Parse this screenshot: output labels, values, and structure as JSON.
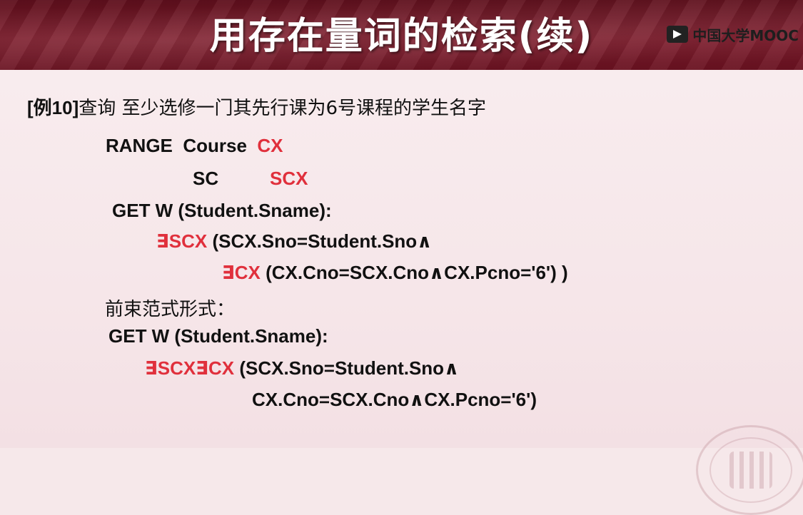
{
  "title": "用存在量词的检索(续)",
  "mooc_label": "中国大学MOOC",
  "example": {
    "label": "[例10]",
    "question": "查询 至少选修一门其先行课为6号课程的学生名字"
  },
  "query1": {
    "range_keyword": "RANGE",
    "range_table1": "Course",
    "range_alias1": "CX",
    "range_table2": "SC",
    "range_alias2": "SCX",
    "get_line": "GET  W  (Student.Sname):",
    "exists1_symbol": "∃SCX",
    "exists1_body": " (SCX.Sno=Student.Sno∧",
    "exists2_symbol": "∃CX",
    "exists2_body": " (CX.Cno=SCX.Cno∧CX.Pcno='6')  )"
  },
  "prenex": {
    "label": "前束范式形式：",
    "get_line": "GET  W  (Student.Sname):",
    "exists_symbol": "∃SCX∃CX",
    "body_line1": " (SCX.Sno=Student.Sno∧",
    "body_line2": "CX.Cno=SCX.Cno∧CX.Pcno='6')"
  },
  "colors": {
    "header_bg": "#6e1423",
    "highlight_red": "#e0303c",
    "content_bg": "#f6e8ea"
  }
}
